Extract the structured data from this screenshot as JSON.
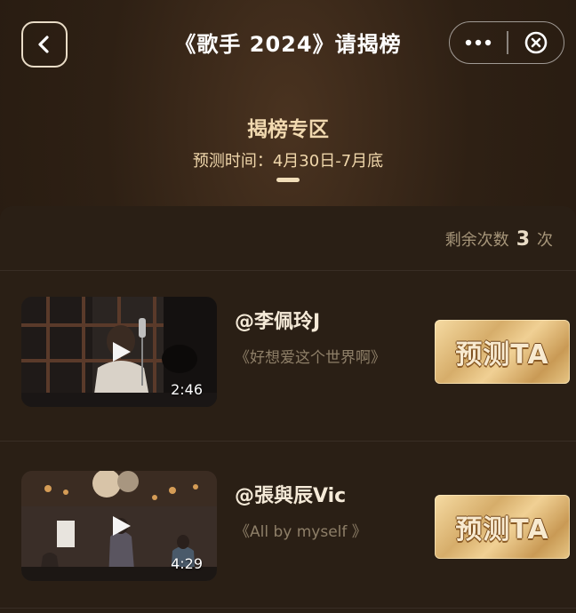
{
  "nav": {
    "title": "《歌手 2024》请揭榜",
    "back_icon": "chevron-left-icon",
    "more_icon": "more-dots-icon",
    "close_icon": "close-circle-icon"
  },
  "header": {
    "section_title": "揭榜专区",
    "subtitle": "预测时间：4月30日-7月底"
  },
  "panel": {
    "remaining_prefix": "剩余次数",
    "remaining_count": "3",
    "remaining_suffix": "次"
  },
  "entries": [
    {
      "singer": "@李佩玲J",
      "song": "《好想爱这个世界啊》",
      "duration": "2:46",
      "button": "预测TA"
    },
    {
      "singer": "@張與辰Vic",
      "song": "《All by myself 》",
      "duration": "4:29",
      "button": "预测TA"
    }
  ],
  "colors": {
    "accent_gold": "#d6ad6a",
    "background": "#2a1f15",
    "title_text": "#f1d9b0"
  }
}
